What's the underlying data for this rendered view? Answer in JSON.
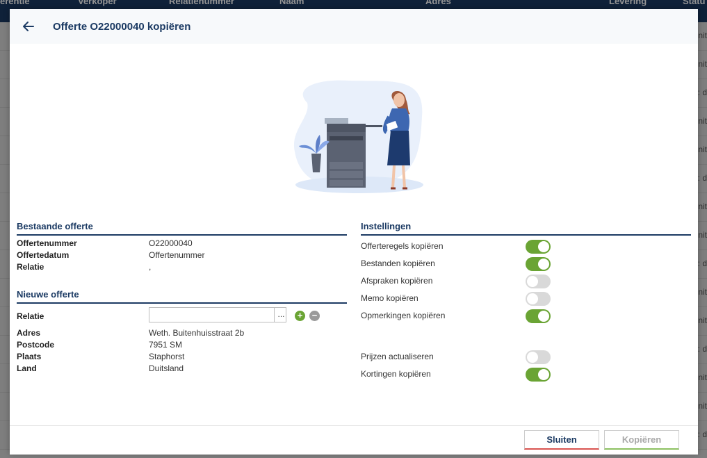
{
  "background": {
    "header_cols": [
      "erentie",
      "Verkoper",
      "Relatienummer",
      "Naam",
      "Adres",
      "Levering",
      "Statu"
    ],
    "row_hints": [
      "nit",
      "nit",
      ": d",
      "nit",
      "nit",
      ": d",
      "nit",
      "nit",
      ": d",
      "nit",
      "nit",
      ": d",
      "nit",
      "nit",
      ": d"
    ]
  },
  "modal": {
    "title": "Offerte O22000040 kopiëren",
    "bestaande": {
      "section_title": "Bestaande offerte",
      "offertenummer_label": "Offertenummer",
      "offertenummer_value": "O22000040",
      "offertedatum_label": "Offertedatum",
      "offertedatum_value": "Offertenummer",
      "relatie_label": "Relatie",
      "relatie_value": ","
    },
    "nieuwe": {
      "section_title": "Nieuwe offerte",
      "relatie_label": "Relatie",
      "relatie_input_value": "",
      "relatie_lookup": "...",
      "adres_label": "Adres",
      "adres_value": "Weth. Buitenhuisstraat 2b",
      "postcode_label": "Postcode",
      "postcode_value": "7951 SM",
      "plaats_label": "Plaats",
      "plaats_value": "Staphorst",
      "land_label": "Land",
      "land_value": "Duitsland"
    },
    "instellingen": {
      "section_title": "Instellingen",
      "items": [
        {
          "label": "Offerteregels kopiëren",
          "on": true
        },
        {
          "label": "Bestanden kopiëren",
          "on": true
        },
        {
          "label": "Afspraken kopiëren",
          "on": false
        },
        {
          "label": "Memo kopiëren",
          "on": false
        },
        {
          "label": "Opmerkingen kopiëren",
          "on": true
        },
        {
          "label": "Prijzen actualiseren",
          "on": false
        },
        {
          "label": "Kortingen kopiëren",
          "on": true
        }
      ]
    },
    "footer": {
      "close_label": "Sluiten",
      "copy_label": "Kopiëren"
    }
  },
  "colors": {
    "primary": "#1b3a63",
    "toggle_on": "#6aa434",
    "toggle_off": "#d9d9d9",
    "close_accent": "#d9534f",
    "copy_accent": "#8cc060"
  }
}
